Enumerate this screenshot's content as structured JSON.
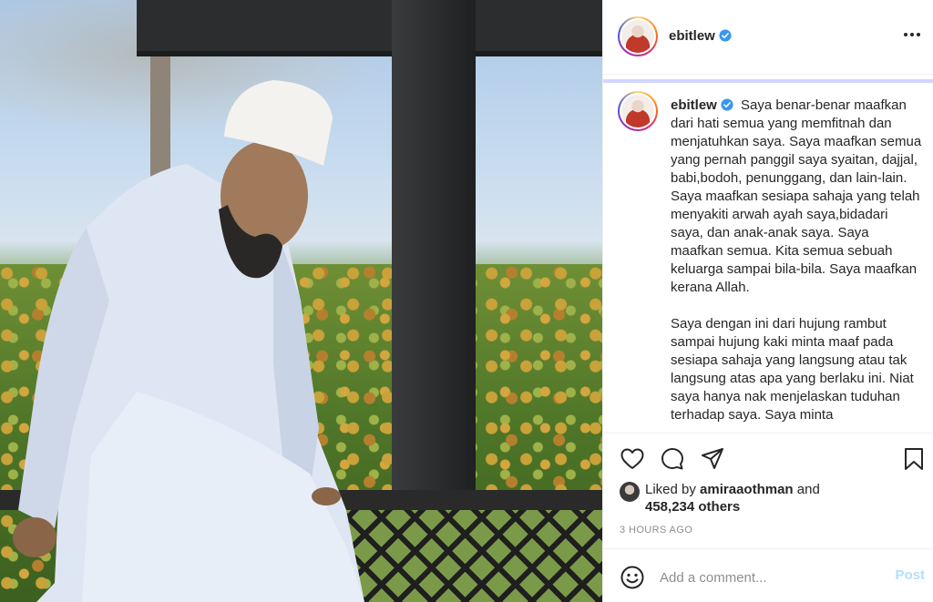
{
  "post": {
    "username": "ebitlew",
    "caption": "Saya benar-benar maafkan dari hati semua yang memfitnah dan menjatuhkan saya. Saya maafkan semua yang pernah panggil saya syaitan, dajjal, babi,bodoh, penunggang, dan lain-lain. Saya maafkan sesiapa sahaja yang telah menyakiti arwah ayah saya,bidadari saya, dan anak-anak saya. Saya maafkan semua. Kita semua sebuah keluarga sampai bila-bila. Saya maafkan kerana Allah.\n\nSaya dengan ini dari hujung rambut sampai hujung kaki minta maaf pada sesiapa sahaja yang langsung atau tak langsung atas apa yang berlaku ini. Niat saya hanya nak menjelaskan tuduhan terhadap saya. Saya minta"
  },
  "likes": {
    "prefix": "Liked by",
    "user": "amiraaothman",
    "suffix": "and",
    "count": "458,234 others"
  },
  "time": "3 HOURS AGO",
  "comment": {
    "placeholder": "Add a comment...",
    "post_label": "Post"
  },
  "colors": {
    "verified": "#3897f0",
    "post_disabled": "#b2dffc",
    "muted": "#8e8e8e"
  },
  "icons": [
    "verified-badge-icon",
    "more-options-icon",
    "heart-icon",
    "comment-icon",
    "share-icon",
    "bookmark-icon",
    "emoji-icon"
  ]
}
